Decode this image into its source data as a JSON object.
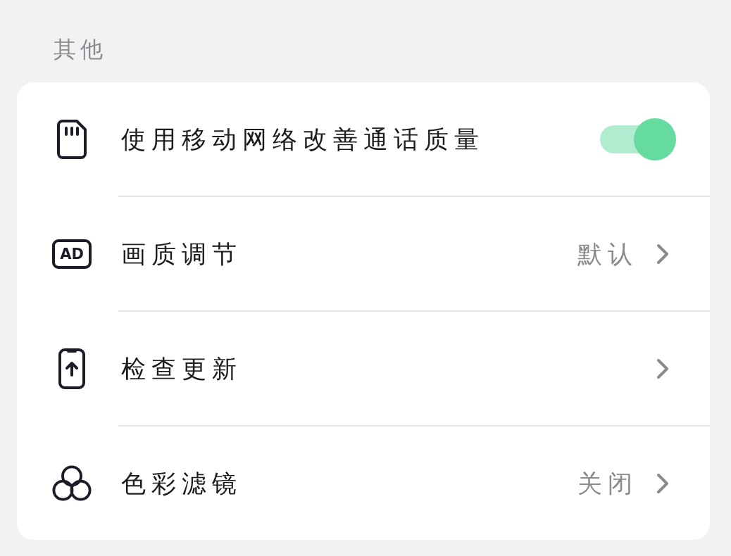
{
  "section_title": "其他",
  "items": [
    {
      "kind": "toggle",
      "label": "使用移动网络改善通话质量",
      "on": true
    },
    {
      "kind": "link",
      "badge": "AD",
      "label": "画质调节",
      "value": "默认"
    },
    {
      "kind": "link",
      "label": "检查更新"
    },
    {
      "kind": "link",
      "label": "色彩滤镜",
      "value": "关闭"
    }
  ]
}
